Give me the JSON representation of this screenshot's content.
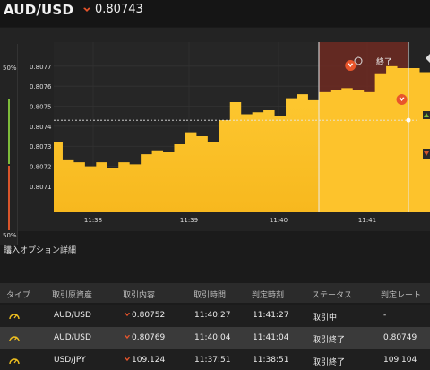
{
  "header": {
    "pair": "AUD/USD",
    "rate": "0.80743",
    "direction_icon": "down-arrow-icon",
    "direction_color": "#e8552b"
  },
  "gauge": {
    "top_label": "50%",
    "bottom_label": "50%",
    "close_label": "×",
    "top_color": "#7dbb3a",
    "bottom_color": "#d9552b"
  },
  "chart_data": {
    "type": "area",
    "title": "",
    "series": [
      {
        "name": "",
        "color": "#fdc32c",
        "x": [
          "11:37:51",
          "11:37:55",
          "11:38:00",
          "11:38:05",
          "11:38:10",
          "11:38:15",
          "11:38:20",
          "11:38:25",
          "11:38:30",
          "11:38:35",
          "11:38:40",
          "11:38:45",
          "11:38:50",
          "11:38:55",
          "11:39:00",
          "11:39:05",
          "11:39:10",
          "11:39:15",
          "11:39:20",
          "11:39:25",
          "11:39:30",
          "11:39:35",
          "11:39:40",
          "11:39:45",
          "11:39:50",
          "11:39:55",
          "11:40:00",
          "11:40:05",
          "11:40:10",
          "11:40:15",
          "11:40:20",
          "11:40:25",
          "11:40:30",
          "11:40:35",
          "11:40:40",
          "11:40:45",
          "11:40:50",
          "11:40:55",
          "11:41:00",
          "11:41:05",
          "11:41:10",
          "11:41:15",
          "11:41:20",
          "11:41:25",
          "11:41:30"
        ],
        "values": [
          0.80732,
          0.80723,
          0.80722,
          0.8072,
          0.80722,
          0.80719,
          0.80722,
          0.80721,
          0.80726,
          0.80728,
          0.80727,
          0.80731,
          0.80737,
          0.80735,
          0.80732,
          0.80743,
          0.80752,
          0.80746,
          0.80747,
          0.80748,
          0.80745,
          0.80754,
          0.80756,
          0.80753,
          0.80757,
          0.80758,
          0.80759,
          0.80758,
          0.80757,
          0.80766,
          0.8077,
          0.80769,
          0.80769,
          0.80767,
          0.80764,
          0.8076,
          0.80745,
          0.80743,
          0.80749,
          0.80746,
          0.80749,
          0.80747,
          0.8075,
          0.80745,
          0.80744
        ]
      }
    ],
    "yticks": [
      "0.8077",
      "0.8076",
      "0.8075",
      "0.8074",
      "0.8073",
      "0.8072",
      "0.8071"
    ],
    "ytick_values": [
      0.8077,
      0.8076,
      0.8075,
      0.8074,
      0.8073,
      0.8072,
      0.8071
    ],
    "xticks": [
      "11:38",
      "11:39",
      "11:40",
      "11:41"
    ],
    "xtick_values_sec": [
      29,
      89,
      149,
      209
    ],
    "ylim": [
      0.80697,
      0.80782
    ],
    "current_rate": 0.80743,
    "expiry_label": "終了",
    "grid": true
  },
  "orders": {
    "section_title": "購入オプション詳細",
    "columns": [
      "タイプ",
      "取引原資産",
      "取引内容",
      "取引時間",
      "判定時刻",
      "ステータス",
      "判定レート"
    ],
    "rows": [
      {
        "asset": "AUD/USD",
        "direction": "down",
        "rate": "0.80752",
        "time": "11:40:27",
        "judge": "11:41:27",
        "status": "取引中",
        "judge_rate": "-"
      },
      {
        "asset": "AUD/USD",
        "direction": "down",
        "rate": "0.80769",
        "time": "11:40:04",
        "judge": "11:41:04",
        "status": "取引終了",
        "judge_rate": "0.80749"
      },
      {
        "asset": "USD/JPY",
        "direction": "down",
        "rate": "109.124",
        "time": "11:37:51",
        "judge": "11:38:51",
        "status": "取引終了",
        "judge_rate": "109.104"
      }
    ],
    "type_icon": "clock-icon",
    "type_icon_color": "#f0c020",
    "down_color": "#e8552b"
  }
}
